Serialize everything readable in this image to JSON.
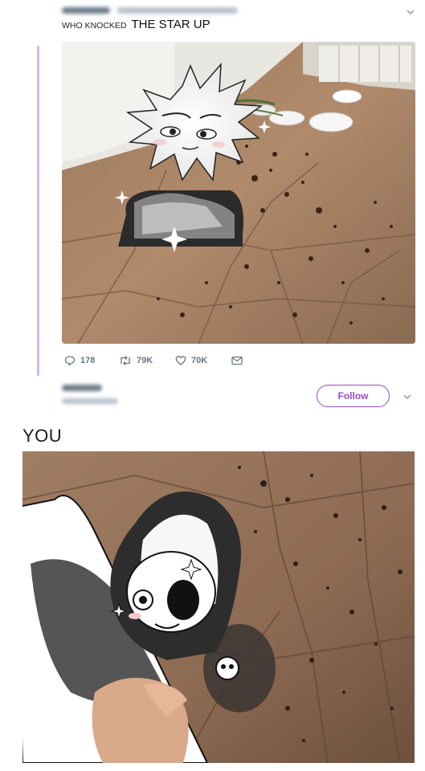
{
  "tweet": {
    "text_small": "WHO KNOCKED",
    "text_large": "THE STAR UP",
    "actions": {
      "replies": "178",
      "retweets": "79K",
      "likes": "70K"
    }
  },
  "profile_card": {
    "follow_label": "Follow"
  },
  "caption": "YOU",
  "colors": {
    "accent": "#9b48c9",
    "thread_line": "#d6b6ea",
    "action_gray": "#657786"
  }
}
